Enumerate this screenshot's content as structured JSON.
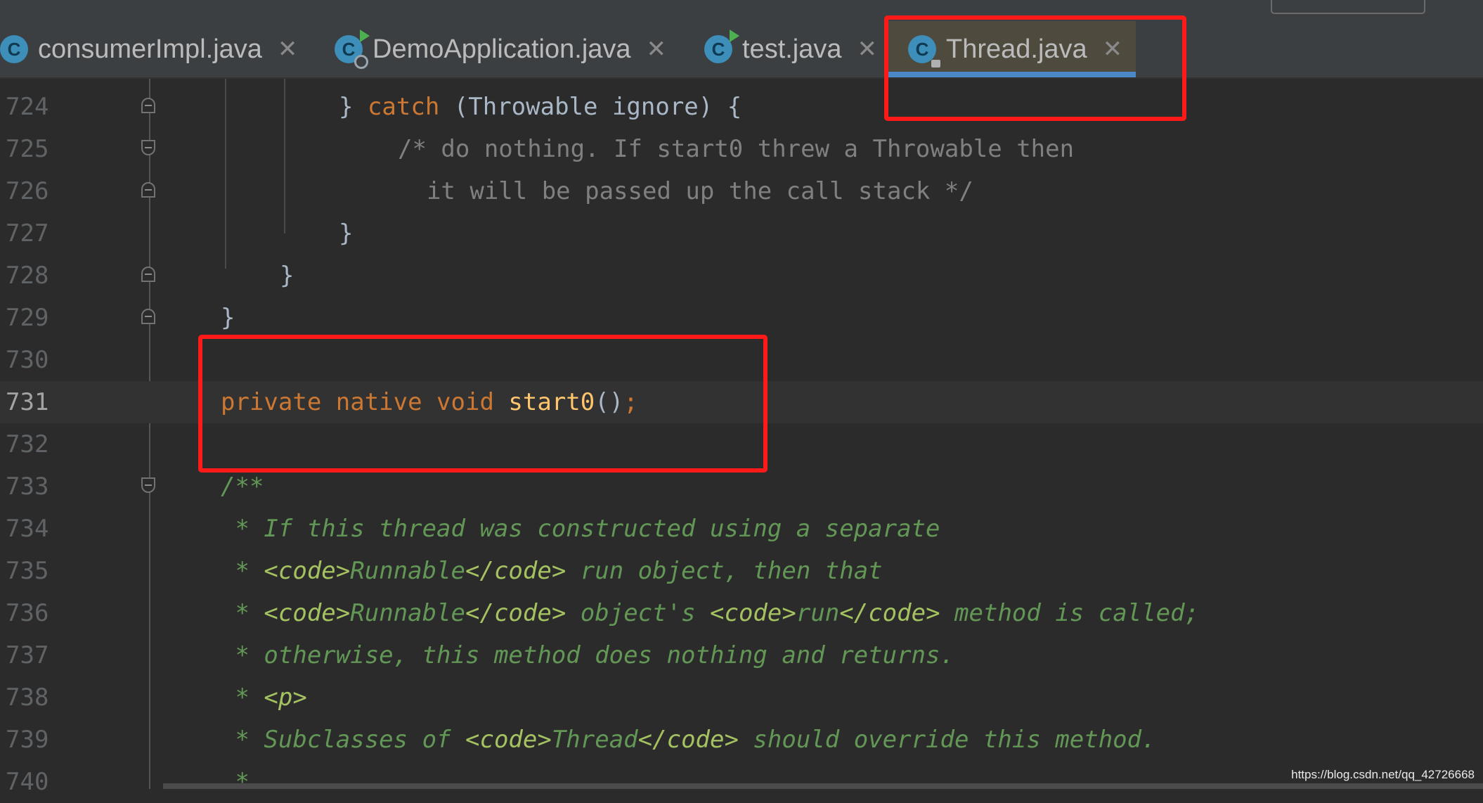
{
  "tabs": [
    {
      "label": "consumerImpl.java",
      "icon": "java-class-icon",
      "active": false
    },
    {
      "label": "DemoApplication.java",
      "icon": "spring-boot-run-class-icon",
      "active": false
    },
    {
      "label": "test.java",
      "icon": "runnable-class-icon",
      "active": false
    },
    {
      "label": "Thread.java",
      "icon": "locked-java-class-icon",
      "active": true
    }
  ],
  "tab_icon_letter": "C",
  "tab_close_glyph": "✕",
  "editor": {
    "lines": [
      {
        "num": "724",
        "tokens": [
          [
            "p",
            "} "
          ],
          [
            "kw",
            "catch"
          ],
          [
            "p",
            " (Throwable ignore) {"
          ]
        ]
      },
      {
        "num": "725",
        "tokens": [
          [
            "cm",
            "/* do nothing. If start0 threw a Throwable then"
          ]
        ]
      },
      {
        "num": "726",
        "tokens": [
          [
            "cm",
            "  it will be passed up the call stack */"
          ]
        ]
      },
      {
        "num": "727",
        "tokens": [
          [
            "p",
            "}"
          ]
        ]
      },
      {
        "num": "728",
        "tokens": [
          [
            "p",
            "}"
          ]
        ]
      },
      {
        "num": "729",
        "tokens": [
          [
            "p",
            "}"
          ]
        ]
      },
      {
        "num": "730",
        "tokens": []
      },
      {
        "num": "731",
        "tokens": [
          [
            "kw",
            "private native void "
          ],
          [
            "fn",
            "start0"
          ],
          [
            "p",
            "()"
          ],
          [
            "kw",
            ";"
          ]
        ]
      },
      {
        "num": "732",
        "tokens": []
      },
      {
        "num": "733",
        "tokens": [
          [
            "doc",
            "/**"
          ]
        ]
      },
      {
        "num": "734",
        "tokens": [
          [
            "doc",
            " * If this thread was constructed using a separate"
          ]
        ]
      },
      {
        "num": "735",
        "tokens": [
          [
            "doc",
            " * "
          ],
          [
            "tag",
            "<code>"
          ],
          [
            "doc",
            "Runnable"
          ],
          [
            "tag",
            "</code>"
          ],
          [
            "doc",
            " run object, then that"
          ]
        ]
      },
      {
        "num": "736",
        "tokens": [
          [
            "doc",
            " * "
          ],
          [
            "tag",
            "<code>"
          ],
          [
            "doc",
            "Runnable"
          ],
          [
            "tag",
            "</code>"
          ],
          [
            "doc",
            " object's "
          ],
          [
            "tag",
            "<code>"
          ],
          [
            "doc",
            "run"
          ],
          [
            "tag",
            "</code>"
          ],
          [
            "doc",
            " method is called;"
          ]
        ]
      },
      {
        "num": "737",
        "tokens": [
          [
            "doc",
            " * otherwise, this method does nothing and returns."
          ]
        ]
      },
      {
        "num": "738",
        "tokens": [
          [
            "doc",
            " * "
          ],
          [
            "tag",
            "<p>"
          ]
        ]
      },
      {
        "num": "739",
        "tokens": [
          [
            "doc",
            " * Subclasses of "
          ],
          [
            "tag",
            "<code>"
          ],
          [
            "doc",
            "Thread"
          ],
          [
            "tag",
            "</code>"
          ],
          [
            "doc",
            " should override this method."
          ]
        ]
      },
      {
        "num": "740",
        "tokens": [
          [
            "doc",
            " *"
          ]
        ]
      }
    ],
    "current_line": "731"
  },
  "watermark": "https://blog.csdn.net/qq_42726668",
  "colors": {
    "background": "#2b2b2b",
    "keyword": "#cc7832",
    "method": "#ffc66d",
    "comment": "#808080",
    "javadoc": "#629755",
    "javadoc_tag": "#a5c261",
    "annotation_box": "#ff1a1a",
    "active_tab_underline": "#4a88c7"
  }
}
